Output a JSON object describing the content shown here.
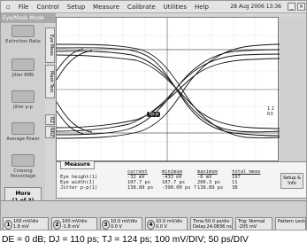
{
  "menu": {
    "items": [
      "File",
      "Control",
      "Setup",
      "Measure",
      "Calibrate",
      "Utilities",
      "Help"
    ],
    "date": "28 Aug 2006 13:36"
  },
  "mode_label": "Eye/Mask Mode",
  "left_buttons": [
    {
      "label": "Extinction Ratio",
      "icon": "extinction-ratio-icon"
    },
    {
      "label": "Jitter RMS",
      "icon": "jitter-rms-icon"
    },
    {
      "label": "Jitter p-p",
      "icon": "jitter-pp-icon"
    },
    {
      "label": "Average Power",
      "icon": "average-power-icon"
    },
    {
      "label": "Crossing Percentage",
      "icon": "crossing-percentage-icon"
    }
  ],
  "more_button": {
    "line1": "More",
    "line2": "(1 of 3)"
  },
  "tabs": {
    "eye_meas": "Eye Meas",
    "mask_test": "Mask Test",
    "rz": "RZ",
    "nrz": "NRZ"
  },
  "scope": {
    "marker": "Tp-p",
    "marker_right": "1 2 R3"
  },
  "measure": {
    "tab_label": "Measure",
    "headers": [
      "",
      "current",
      "minimum",
      "maximum",
      "total meas"
    ],
    "rows": [
      [
        "Eye height(1)",
        "-32 mV",
        "-433 mV",
        "-6 mV",
        "197"
      ],
      [
        "Eye width(1)",
        "107.7 ps",
        "107.7 ps",
        "206.3 ps",
        "11"
      ],
      [
        "Jitter p-p(1)",
        "138.89 ps",
        "-390.00 ps ?",
        "138.89 ps",
        "38"
      ]
    ],
    "setup_label": "Setup & Info"
  },
  "channels": [
    {
      "num": "1",
      "line1": "100 mV/div",
      "line2": "1.6 mV"
    },
    {
      "num": "2",
      "line1": "100 mV/div",
      "line2": "-1.8 mV"
    },
    {
      "num": "3",
      "line1": "10.0 mV/div",
      "line2": "0.0 V"
    },
    {
      "num": "4",
      "line1": "10.0 mV/div",
      "line2": "0.0 V"
    }
  ],
  "time_box": {
    "line1": "Time:50.0 ps/div",
    "line2": "Delay:24.0836 ns"
  },
  "trig_box": {
    "line1": "Trig: Normal",
    "line2": "-205 mV"
  },
  "pattern_lock": "Pattern Lock",
  "caption": "DE = 0 dB; DJ = 110 ps; TJ = 124 ps; 100 mV/DIV; 50 ps/DIV"
}
